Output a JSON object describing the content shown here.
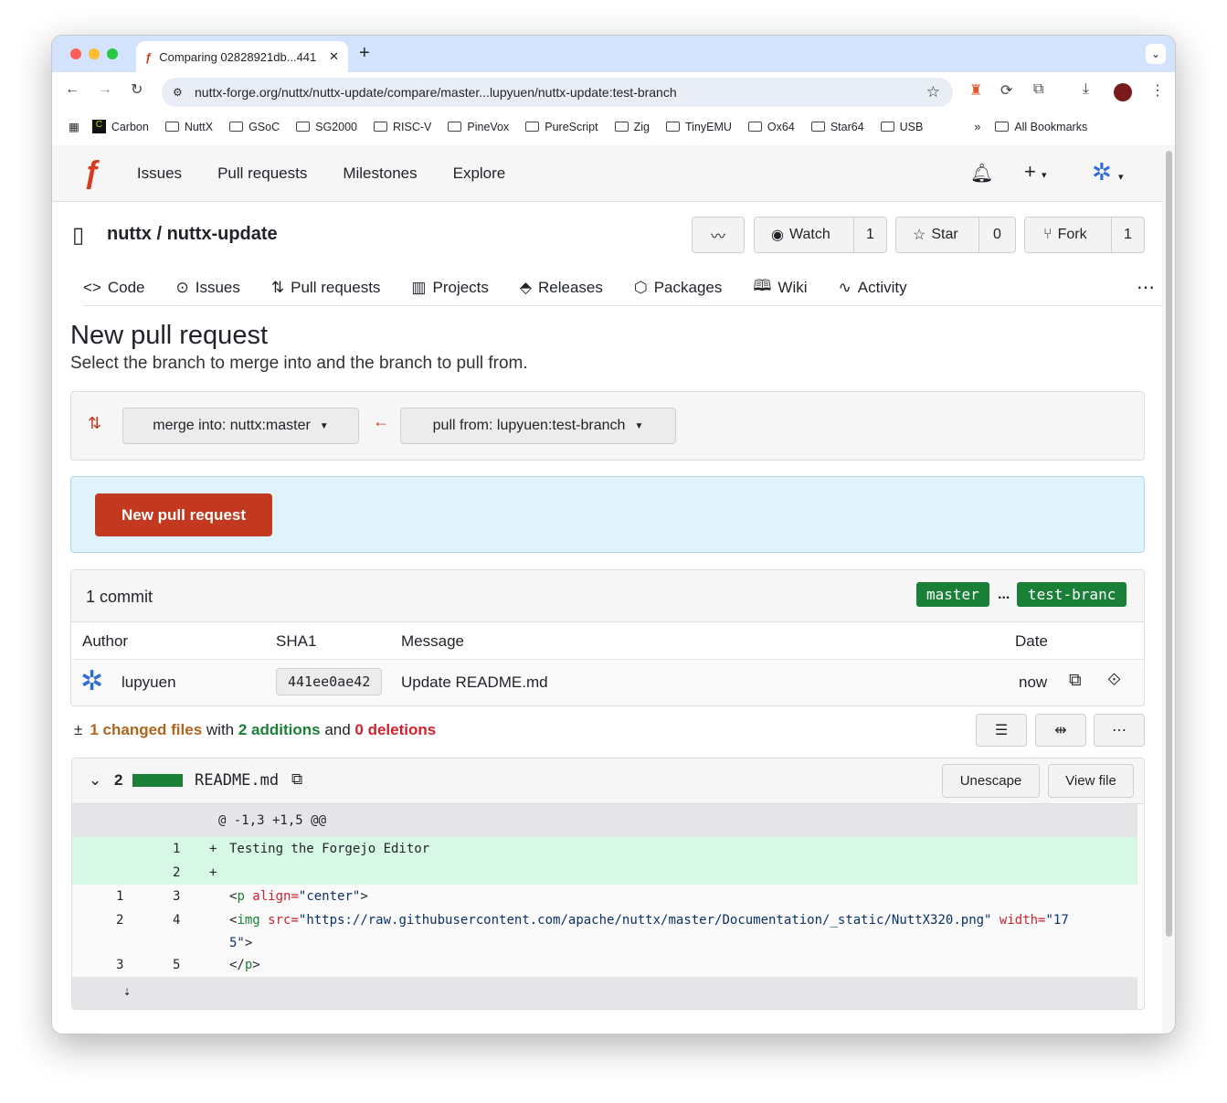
{
  "browser": {
    "tab_title": "Comparing 02828921db...441",
    "url": "nuttx-forge.org/nuttx/nuttx-update/compare/master...lupyuen/nuttx-update:test-branch",
    "bookmarks": [
      "Carbon",
      "NuttX",
      "GSoC",
      "SG2000",
      "RISC-V",
      "PineVox",
      "PureScript",
      "Zig",
      "TinyEMU",
      "Ox64",
      "Star64",
      "USB"
    ],
    "all_bookmarks": "All Bookmarks"
  },
  "nav": {
    "items": [
      "Issues",
      "Pull requests",
      "Milestones",
      "Explore"
    ]
  },
  "repo": {
    "owner": "nuttx",
    "sep": " / ",
    "name": "nuttx-update",
    "watch": "Watch",
    "watch_count": "1",
    "star": "Star",
    "star_count": "0",
    "fork": "Fork",
    "fork_count": "1",
    "tabs": [
      "Code",
      "Issues",
      "Pull requests",
      "Projects",
      "Releases",
      "Packages",
      "Wiki",
      "Activity"
    ]
  },
  "page": {
    "title": "New pull request",
    "subtitle": "Select the branch to merge into and the branch to pull from.",
    "merge_into": "merge into: nuttx:master",
    "pull_from": "pull from: lupyuen:test-branch",
    "new_pr_button": "New pull request"
  },
  "commits": {
    "count": "1 commit",
    "base": "master",
    "ellipsis": "...",
    "head": "test-branc",
    "headers": [
      "Author",
      "SHA1",
      "Message",
      "Date"
    ],
    "rows": [
      {
        "author": "lupyuen",
        "sha": "441ee0ae42",
        "message": "Update README.md",
        "date": "now"
      }
    ]
  },
  "diffstat": {
    "changed": "1 changed files",
    "with": " with ",
    "additions": "2 additions",
    "and": " and ",
    "deletions": "0 deletions"
  },
  "file": {
    "count": "2",
    "name": "README.md",
    "unescape": "Unescape",
    "view_file": "View file",
    "hunk": "@ -1,3 +1,5 @@",
    "lines": [
      {
        "old": "",
        "new": "1",
        "sign": "+",
        "added": true,
        "tokens": [
          {
            "t": "Testing the Forgejo Editor",
            "k": ""
          }
        ]
      },
      {
        "old": "",
        "new": "2",
        "sign": "+",
        "added": true,
        "tokens": []
      },
      {
        "old": "1",
        "new": "3",
        "sign": "",
        "added": false,
        "tokens": [
          {
            "t": "<",
            "k": ""
          },
          {
            "t": "p",
            "k": "tag"
          },
          {
            "t": " align=",
            "k": "attr"
          },
          {
            "t": "\"center\"",
            "k": "str"
          },
          {
            "t": ">",
            "k": ""
          }
        ]
      },
      {
        "old": "2",
        "new": "4",
        "sign": "",
        "added": false,
        "tokens": [
          {
            "t": "<",
            "k": ""
          },
          {
            "t": "img",
            "k": "tag"
          },
          {
            "t": " src=",
            "k": "attr"
          },
          {
            "t": "\"https://raw.githubusercontent.com/apache/nuttx/master/Documentation/_static/NuttX320.png\"",
            "k": "str"
          },
          {
            "t": " width=",
            "k": "attr"
          },
          {
            "t": "\"17",
            "k": "str"
          }
        ]
      },
      {
        "old": "",
        "new": "",
        "sign": "",
        "added": false,
        "tokens": [
          {
            "t": "5\"",
            "k": "str"
          },
          {
            "t": ">",
            "k": ""
          }
        ]
      },
      {
        "old": "3",
        "new": "5",
        "sign": "",
        "added": false,
        "tokens": [
          {
            "t": "</",
            "k": ""
          },
          {
            "t": "p",
            "k": "tag"
          },
          {
            "t": ">",
            "k": ""
          }
        ]
      }
    ]
  },
  "colors": {
    "accent": "#c2391f",
    "green": "#1a7f37",
    "added_bg": "#d7f8e4",
    "info_bg": "#e0f3fc"
  }
}
